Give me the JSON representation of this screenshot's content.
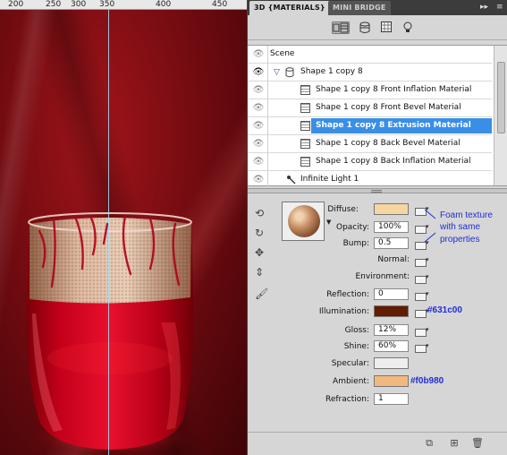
{
  "ruler": {
    "labels": [
      "200",
      "250",
      "300",
      "350",
      "400",
      "450"
    ]
  },
  "panel": {
    "tabs": {
      "active": "3D {MATERIALS}",
      "inactive": "MINI BRIDGE"
    },
    "controls": {
      "expand": "▸▸",
      "menu": "≡"
    },
    "toolbar": {
      "icons": [
        "scene-filter-icon",
        "mesh-filter-icon",
        "material-filter-icon",
        "light-filter-icon"
      ]
    },
    "scene": {
      "rows": [
        {
          "label": "Scene",
          "eye": false,
          "kind": "scene"
        },
        {
          "label": "Shape 1 copy 8",
          "eye": true,
          "kind": "mesh"
        },
        {
          "label": "Shape 1 copy 8 Front Inflation Material",
          "eye": false,
          "kind": "material"
        },
        {
          "label": "Shape 1 copy 8 Front Bevel Material",
          "eye": false,
          "kind": "material"
        },
        {
          "label": "Shape 1 copy 8 Extrusion Material",
          "eye": false,
          "kind": "material",
          "selected": true
        },
        {
          "label": "Shape 1 copy 8 Back Bevel Material",
          "eye": false,
          "kind": "material"
        },
        {
          "label": "Shape 1 copy 8 Back Inflation Material",
          "eye": false,
          "kind": "material"
        },
        {
          "label": "Infinite Light 1",
          "eye": false,
          "kind": "light"
        }
      ]
    },
    "material": {
      "diffuse": {
        "label": "Diffuse:",
        "color": "#f6d6a0"
      },
      "opacity": {
        "label": "Opacity:",
        "value": "100%"
      },
      "bump": {
        "label": "Bump:",
        "value": "0.5"
      },
      "normal": {
        "label": "Normal:"
      },
      "environment": {
        "label": "Environment:"
      },
      "reflection": {
        "label": "Reflection:",
        "value": "0"
      },
      "illumination": {
        "label": "Illumination:",
        "color": "#631c00"
      },
      "gloss": {
        "label": "Gloss:",
        "value": "12%"
      },
      "shine": {
        "label": "Shine:",
        "value": "60%"
      },
      "specular": {
        "label": "Specular:",
        "color": "#eeeeee"
      },
      "ambient": {
        "label": "Ambient:",
        "color": "#f0b980"
      },
      "refraction": {
        "label": "Refraction:",
        "value": "1"
      }
    },
    "annotations": {
      "foam_line1": "Foam texture",
      "foam_line2": "with same",
      "foam_line3": "properties",
      "illumination_hex": "#631c00",
      "ambient_hex": "#f0b980"
    },
    "colors": {
      "selection": "#3a8ee6",
      "annotation": "#1e2fd6",
      "tab_bar": "#3c3c3c"
    }
  }
}
